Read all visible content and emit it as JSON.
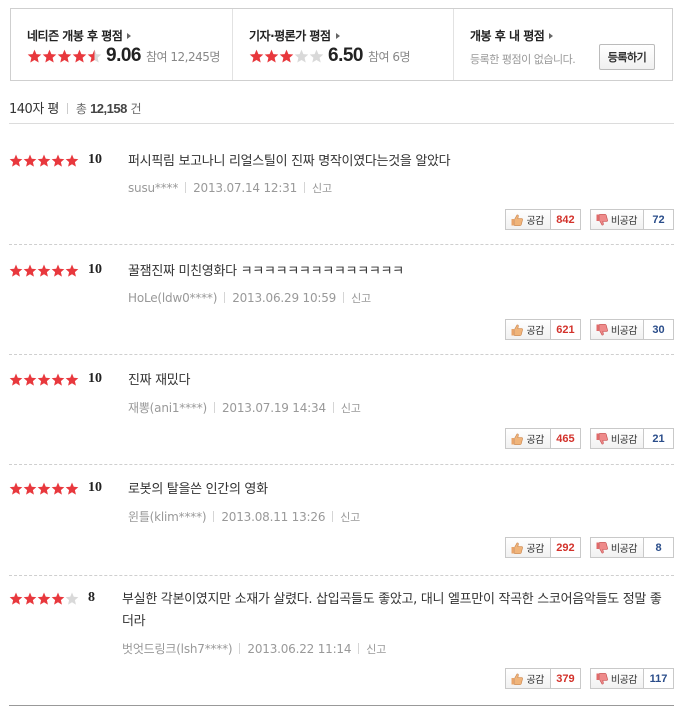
{
  "summary": {
    "netizen": {
      "title": "네티즌 개봉 후 평점",
      "rating": 4.5,
      "score": "9.06",
      "participants": "참여 12,245명"
    },
    "critics": {
      "title": "기자·평론가 평점",
      "rating": 3,
      "score": "6.50",
      "participants": "참여 6명"
    },
    "mine": {
      "title": "개봉 후 내 평점",
      "empty_message": "등록한 평점이 없습니다.",
      "register_label": "등록하기"
    }
  },
  "list": {
    "heading": "140자 평",
    "total_label": "총",
    "total_count": "12,158",
    "total_unit": "건"
  },
  "colors": {
    "star_on": "#e8383d",
    "star_off": "#d9d9d9",
    "agree": "#d3322b",
    "disagree": "#2a4d8a"
  },
  "reviews": [
    {
      "rating": 5,
      "score": "10",
      "text": "퍼시픽림 보고나니 리얼스틸이 진짜 명작이였다는것을 알았다",
      "author": "susu****",
      "date": "2013.07.14 12:31",
      "report": "신고",
      "agree_label": "공감",
      "agree": "842",
      "disagree_label": "비공감",
      "disagree": "72"
    },
    {
      "rating": 5,
      "score": "10",
      "text": "꿀잼진짜 미친영화다 ㅋㅋㅋㅋㅋㅋㅋㅋㅋㅋㅋㅋㅋㅋ",
      "author": "HoLe(ldw0****)",
      "date": "2013.06.29 10:59",
      "report": "신고",
      "agree_label": "공감",
      "agree": "621",
      "disagree_label": "비공감",
      "disagree": "30"
    },
    {
      "rating": 5,
      "score": "10",
      "text": "진짜 재밌다",
      "author": "재뽕(ani1****)",
      "date": "2013.07.19 14:34",
      "report": "신고",
      "agree_label": "공감",
      "agree": "465",
      "disagree_label": "비공감",
      "disagree": "21"
    },
    {
      "rating": 5,
      "score": "10",
      "text": "로봇의 탈을쓴 인간의 영화",
      "author": "윈틀(klim****)",
      "date": "2013.08.11 13:26",
      "report": "신고",
      "agree_label": "공감",
      "agree": "292",
      "disagree_label": "비공감",
      "disagree": "8"
    },
    {
      "rating": 4,
      "score": "8",
      "text": "부실한 각본이였지만 소재가 살렸다. 삽입곡들도 좋았고, 대니 엘프만이 작곡한 스코어음악들도 정말 좋더라",
      "author": "벗엇드링크(lsh7****)",
      "date": "2013.06.22 11:14",
      "report": "신고",
      "agree_label": "공감",
      "agree": "379",
      "disagree_label": "비공감",
      "disagree": "117"
    }
  ]
}
